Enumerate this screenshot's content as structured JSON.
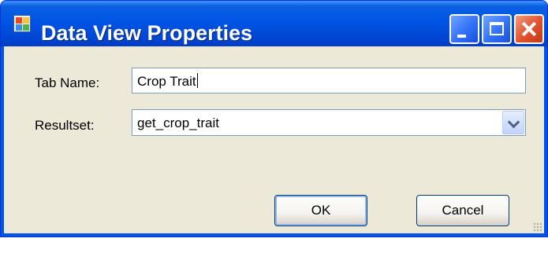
{
  "window": {
    "title": "Data View Properties",
    "icon": "data-view-app-icon"
  },
  "caption_buttons": {
    "minimize_icon": "minimize-icon",
    "maximize_icon": "maximize-icon",
    "close_icon": "close-icon"
  },
  "form": {
    "tab_name_label": "Tab Name:",
    "tab_name_value": "Crop Trait",
    "resultset_label": "Resultset:",
    "resultset_value": "get_crop_trait",
    "resultset_dropdown_icon": "chevron-down-icon"
  },
  "buttons": {
    "ok_label": "OK",
    "cancel_label": "Cancel"
  },
  "colors": {
    "titlebar": "#0054e3",
    "client_background": "#ece9d8",
    "close_button": "#e0512e"
  }
}
